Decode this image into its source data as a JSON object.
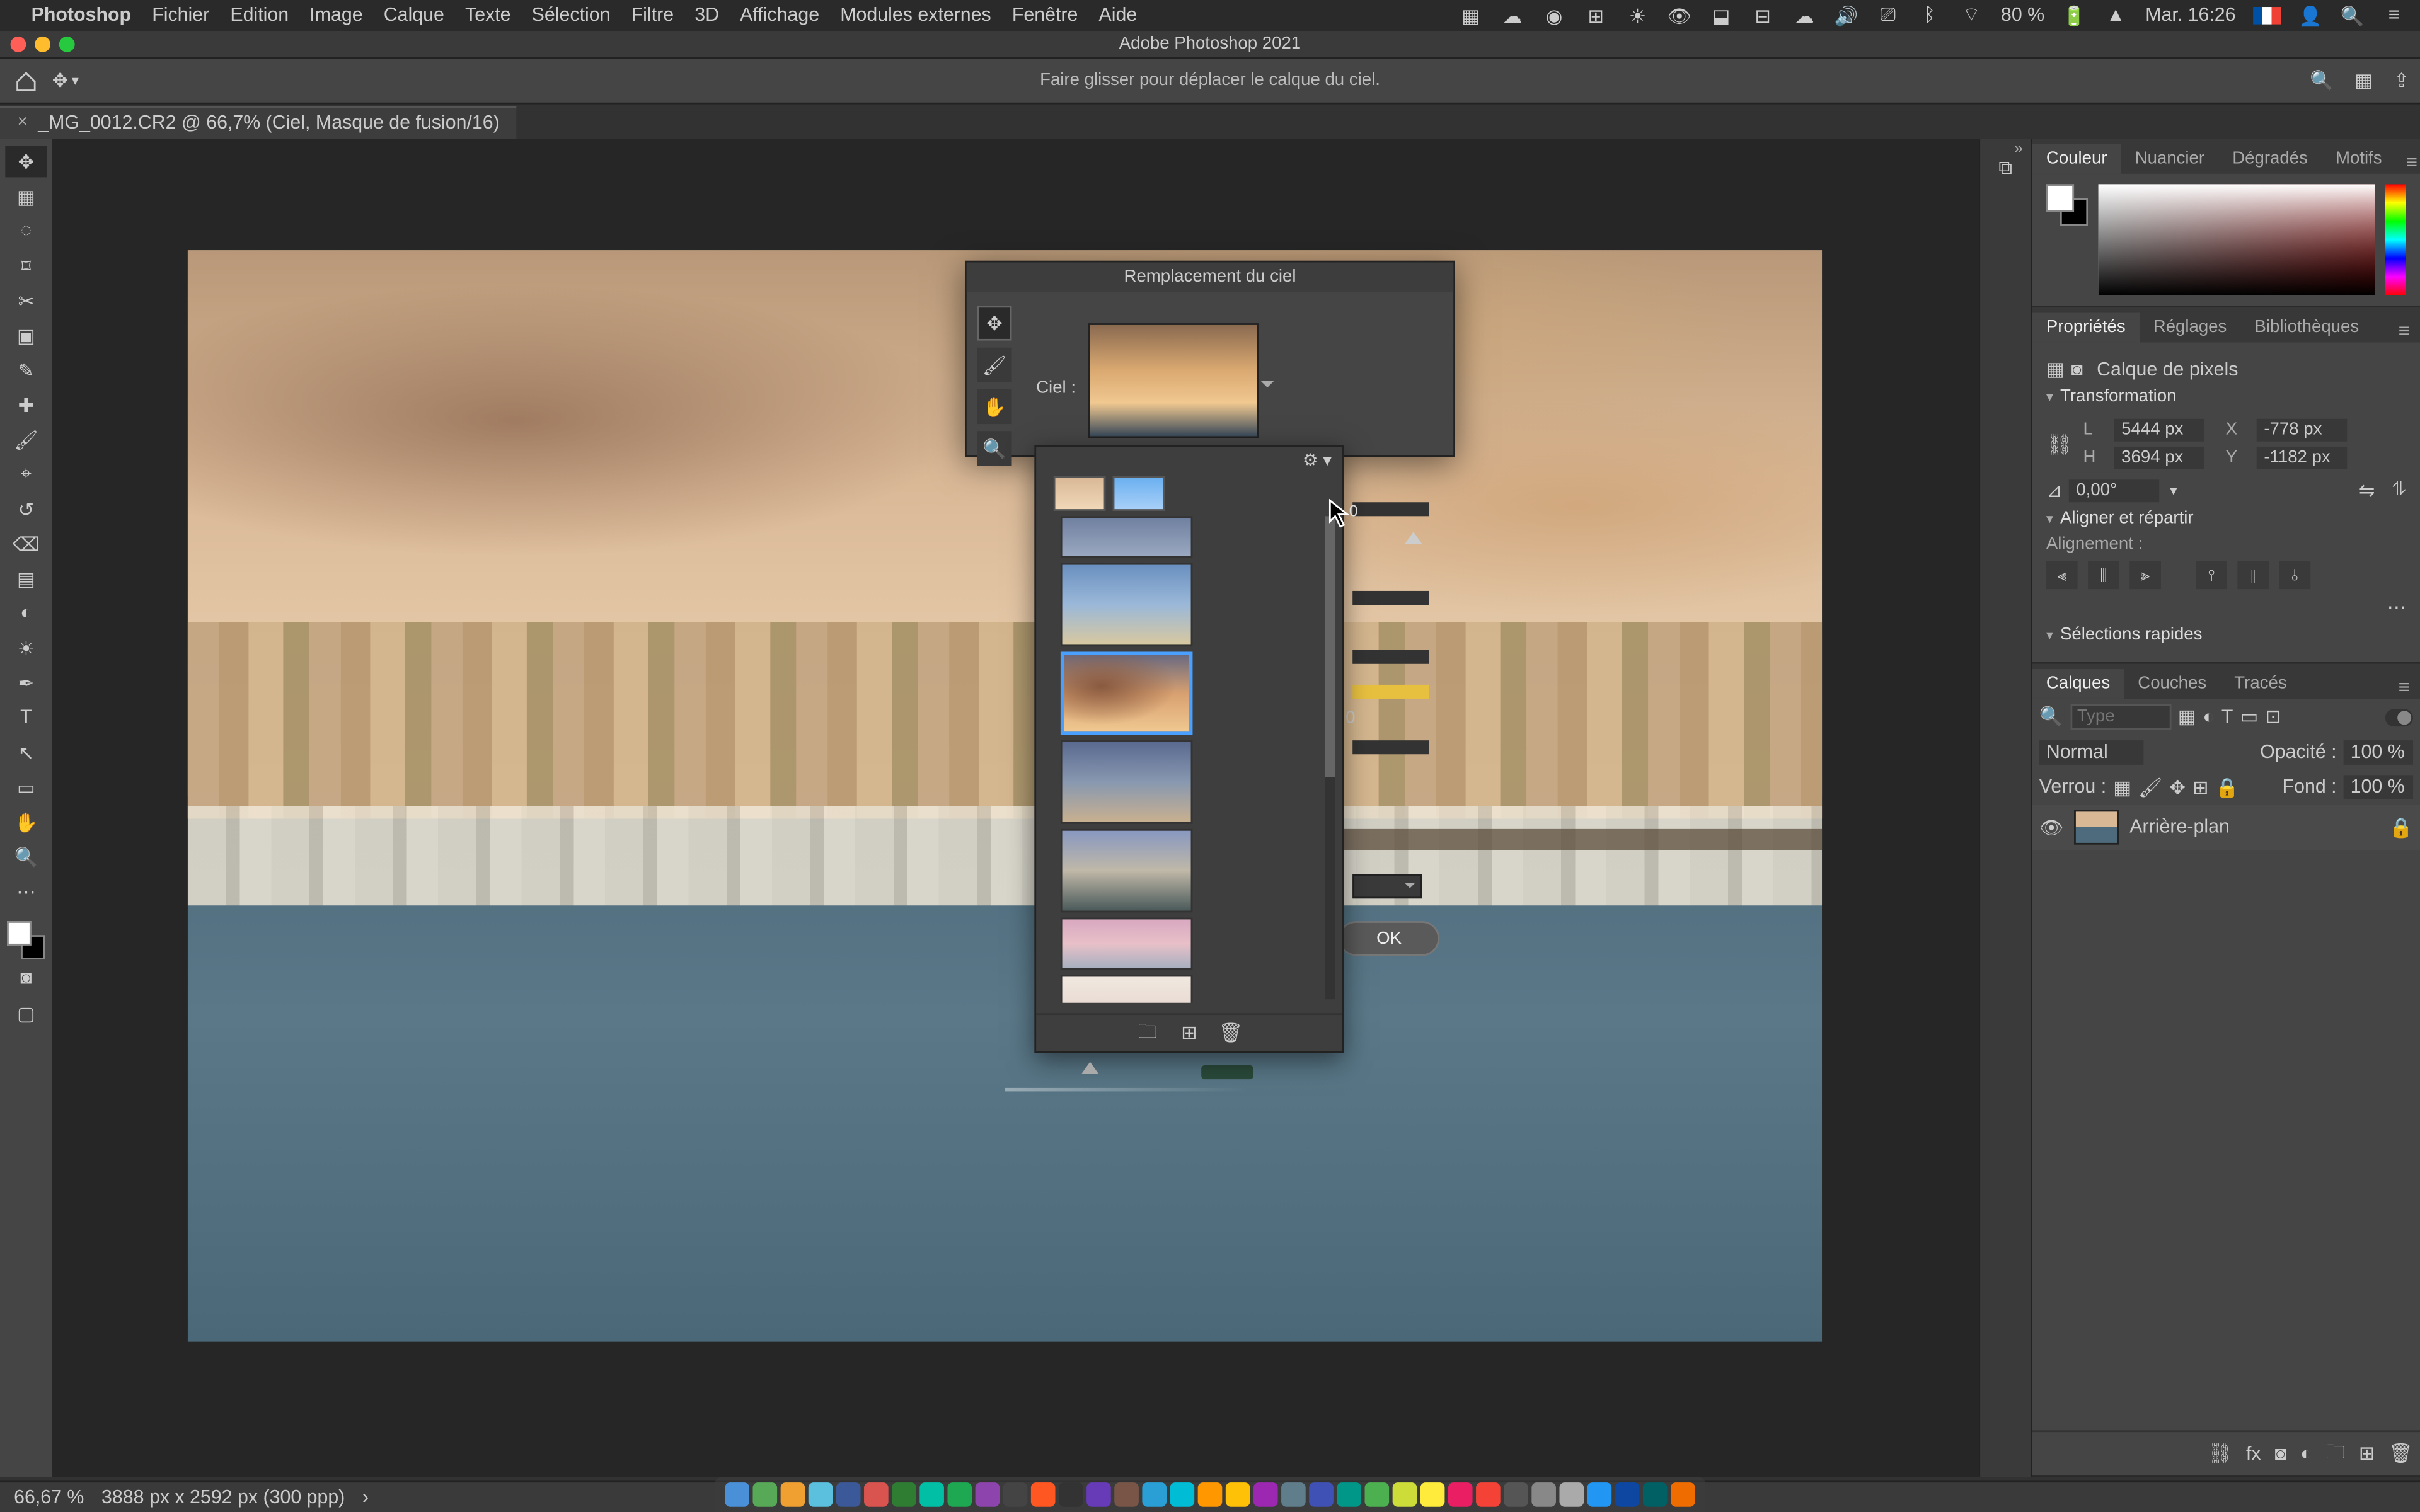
{
  "menubar": {
    "app": "Photoshop",
    "items": [
      "Fichier",
      "Edition",
      "Image",
      "Calque",
      "Texte",
      "Sélection",
      "Filtre",
      "3D",
      "Affichage",
      "Modules externes",
      "Fenêtre",
      "Aide"
    ],
    "right": {
      "battery": "80 %",
      "clock": "Mar. 16:26",
      "wifi": "wifi-icon",
      "flag": "fr"
    }
  },
  "titlebar": "Adobe Photoshop 2021",
  "optbar_hint": "Faire glisser pour déplacer le calque du ciel.",
  "doc_tab": {
    "close": "×",
    "title": "_MG_0012.CR2 @ 66,7% (Ciel, Masque de fusion/16)"
  },
  "tools": [
    "move",
    "artboard",
    "lasso",
    "marquee",
    "crop",
    "frame",
    "eyedrop",
    "heal",
    "brush",
    "stamp",
    "history",
    "eraser",
    "gradient",
    "blur",
    "dodge",
    "pen",
    "type",
    "path",
    "rect",
    "hand",
    "zoom",
    "more",
    "edit-toolbar",
    "quick-mask",
    "screen-mode"
  ],
  "tool_glyphs": [
    "✥",
    "▦",
    "⌑",
    "◌",
    "✂",
    "▣",
    "✎",
    "✚",
    "🖌",
    "⌖",
    "↺",
    "⌫",
    "▤",
    "◐",
    "☀",
    "✒",
    "T",
    "↖",
    "▭",
    "✋",
    "🔍",
    "⋯",
    "⊞",
    "◙",
    "▢"
  ],
  "sky_dialog": {
    "title": "Remplacement du ciel",
    "label": "Ciel :",
    "ok": "OK",
    "val0": "0"
  },
  "panels": {
    "color": {
      "tabs": [
        "Couleur",
        "Nuancier",
        "Dégradés",
        "Motifs"
      ]
    },
    "props": {
      "tabs": [
        "Propriétés",
        "Réglages",
        "Bibliothèques"
      ],
      "type": "Calque de pixels",
      "section1": "Transformation",
      "L": "5444 px",
      "X": "-778 px",
      "H": "3694 px",
      "Y": "-1182 px",
      "angle": "0,00°",
      "section2": "Aligner et répartir",
      "align_label": "Alignement :",
      "section3": "Sélections rapides"
    },
    "layers": {
      "tabs": [
        "Calques",
        "Couches",
        "Tracés"
      ],
      "type_ph": "Type",
      "blend": "Normal",
      "opacity_lbl": "Opacité :",
      "opacity_val": "100 %",
      "lock_lbl": "Verrou :",
      "fill_lbl": "Fond :",
      "fill_val": "100 %",
      "layer_name": "Arrière-plan"
    }
  },
  "status": {
    "zoom": "66,67 %",
    "info": "3888 px x 2592 px (300 ppp)"
  },
  "cursor_value": "0",
  "dock_colors": [
    "#4a90d9",
    "#57a957",
    "#f0a030",
    "#5bc0de",
    "#3b5998",
    "#d9534f",
    "#2e7d32",
    "#00bfa5",
    "#1da851",
    "#8e44ad",
    "#444",
    "#ff5722",
    "#333",
    "#673ab7",
    "#795548",
    "#2a9fd6",
    "#00bcd4",
    "#ff9800",
    "#ffc107",
    "#9c27b0",
    "#607d8b",
    "#3f51b5",
    "#009688",
    "#4caf50",
    "#cddc39",
    "#ffeb3b",
    "#e91e63",
    "#f44336",
    "#555",
    "#888",
    "#aaa",
    "#2196f3",
    "#0d47a1",
    "#006064",
    "#ef6c00"
  ]
}
